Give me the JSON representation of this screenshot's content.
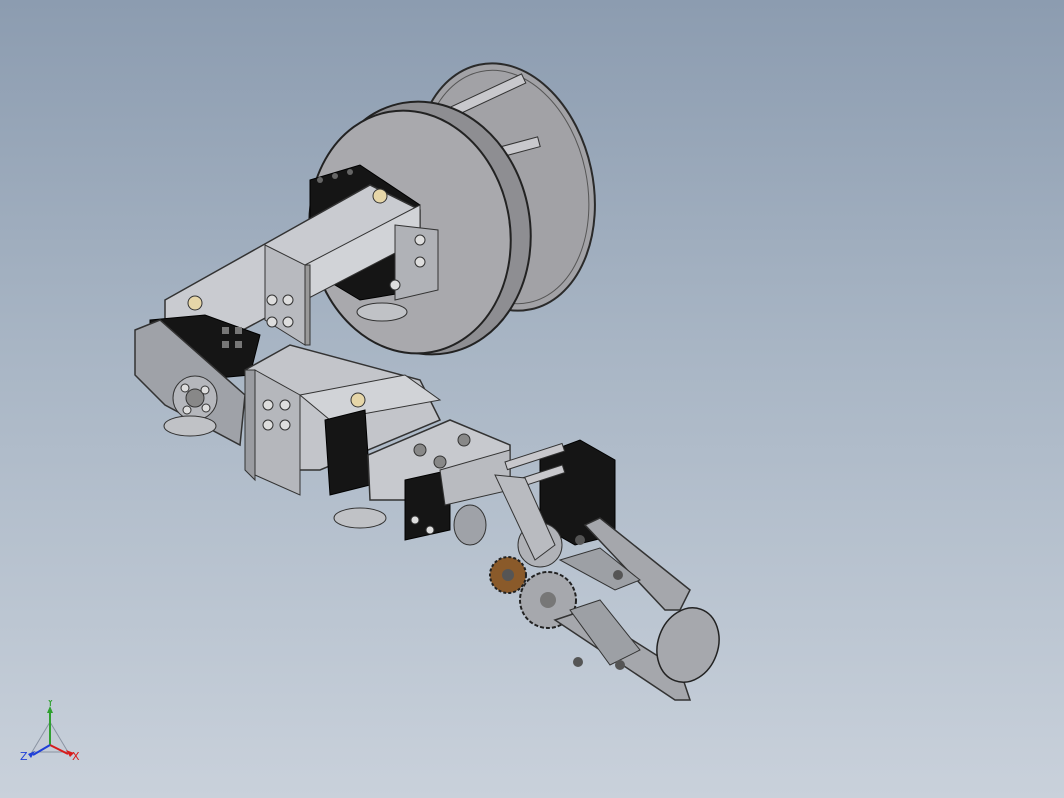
{
  "triad": {
    "x_label": "X",
    "y_label": "Y",
    "z_label": "Z",
    "x_color": "#d81b1b",
    "y_color": "#2fa02f",
    "z_color": "#1f3fd8"
  },
  "colors": {
    "background_top": "#8c9cb0",
    "background_bottom": "#c9d1db",
    "metal": "#b4b7bd",
    "servo": "#151515",
    "wheel": "#a2a2a6",
    "gear_brass": "#8a5a2a"
  }
}
